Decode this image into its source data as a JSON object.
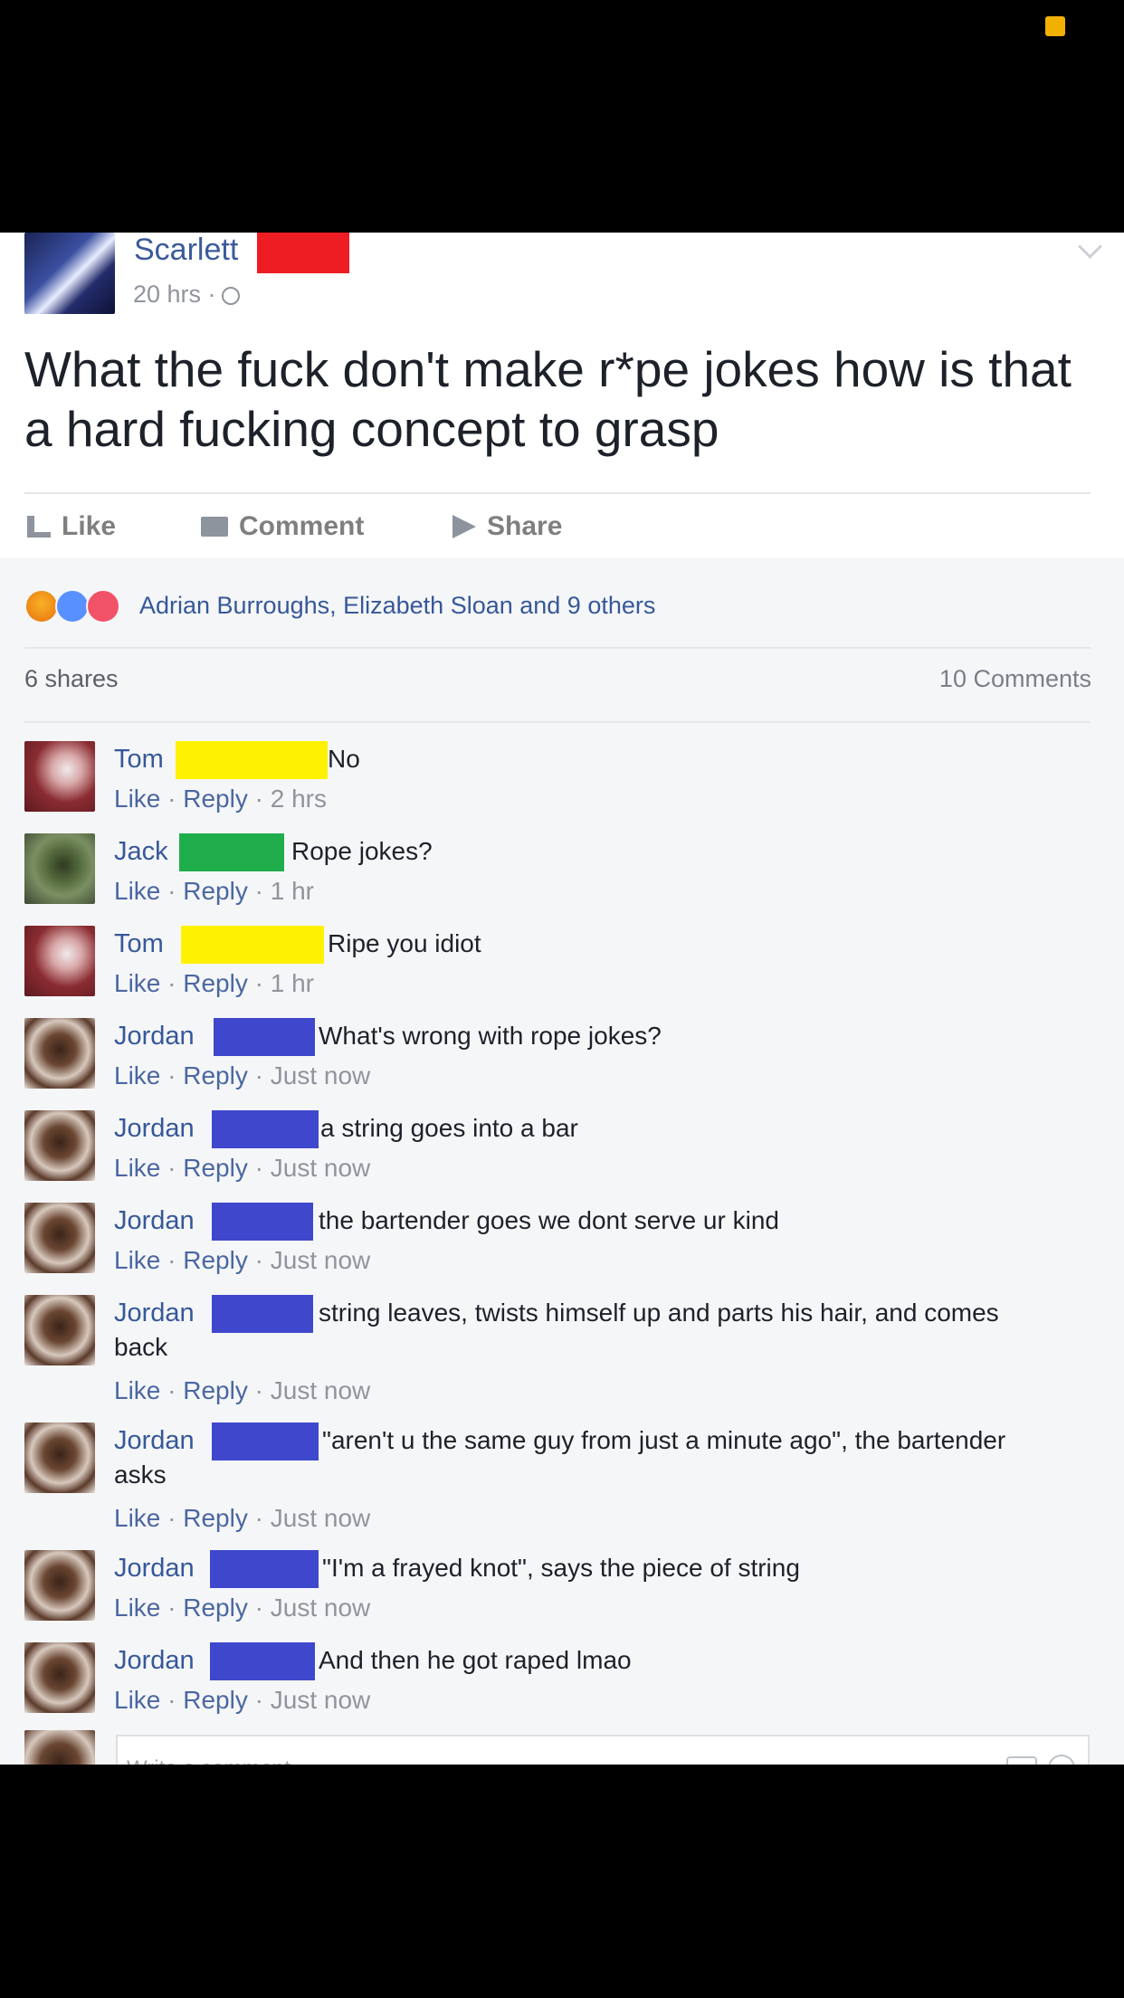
{
  "post": {
    "author": "Scarlett",
    "time": "20 hrs ·",
    "text": "What the fuck don't make r*pe jokes how is that a hard fucking concept to grasp",
    "actions": {
      "like": "Like",
      "comment": "Comment",
      "share": "Share"
    },
    "reactions_text": "Adrian Burroughs, Elizabeth Sloan and 9 others",
    "shares": "6 shares",
    "comments_count": "10 Comments"
  },
  "comment_meta": {
    "like": "Like",
    "sep": " · ",
    "reply": "Reply"
  },
  "comments": [
    {
      "name": "Tom",
      "text": "No",
      "time": "2 hrs"
    },
    {
      "name": "Jack",
      "text": "Rope jokes?",
      "time": "1 hr"
    },
    {
      "name": "Tom",
      "text": "Ripe you idiot",
      "time": "1 hr"
    },
    {
      "name": "Jordan",
      "text": "What's wrong with rope jokes?",
      "time": "Just now"
    },
    {
      "name": "Jordan",
      "text": "a string goes into a bar",
      "time": "Just now"
    },
    {
      "name": "Jordan",
      "text": "the bartender goes we dont serve ur kind",
      "time": "Just now"
    },
    {
      "name": "Jordan",
      "text": "string leaves, twists himself up and parts his hair, and comes",
      "text_wrap": "back",
      "time": "Just now"
    },
    {
      "name": "Jordan",
      "text": "\"aren't u the same guy from just a minute ago\", the bartender",
      "text_wrap": "asks",
      "time": "Just now"
    },
    {
      "name": "Jordan",
      "text": "\"I'm a frayed knot\", says the piece of string",
      "time": "Just now"
    },
    {
      "name": "Jordan",
      "text": "And then he got raped lmao",
      "time": "Just now"
    }
  ],
  "write_comment_placeholder": "Write a comment...",
  "colors": {
    "redact_red": "#ee1c23",
    "redact_yellow": "#fff200",
    "redact_green": "#1fae4b",
    "redact_blue": "#3f48cc",
    "link": "#365899"
  }
}
